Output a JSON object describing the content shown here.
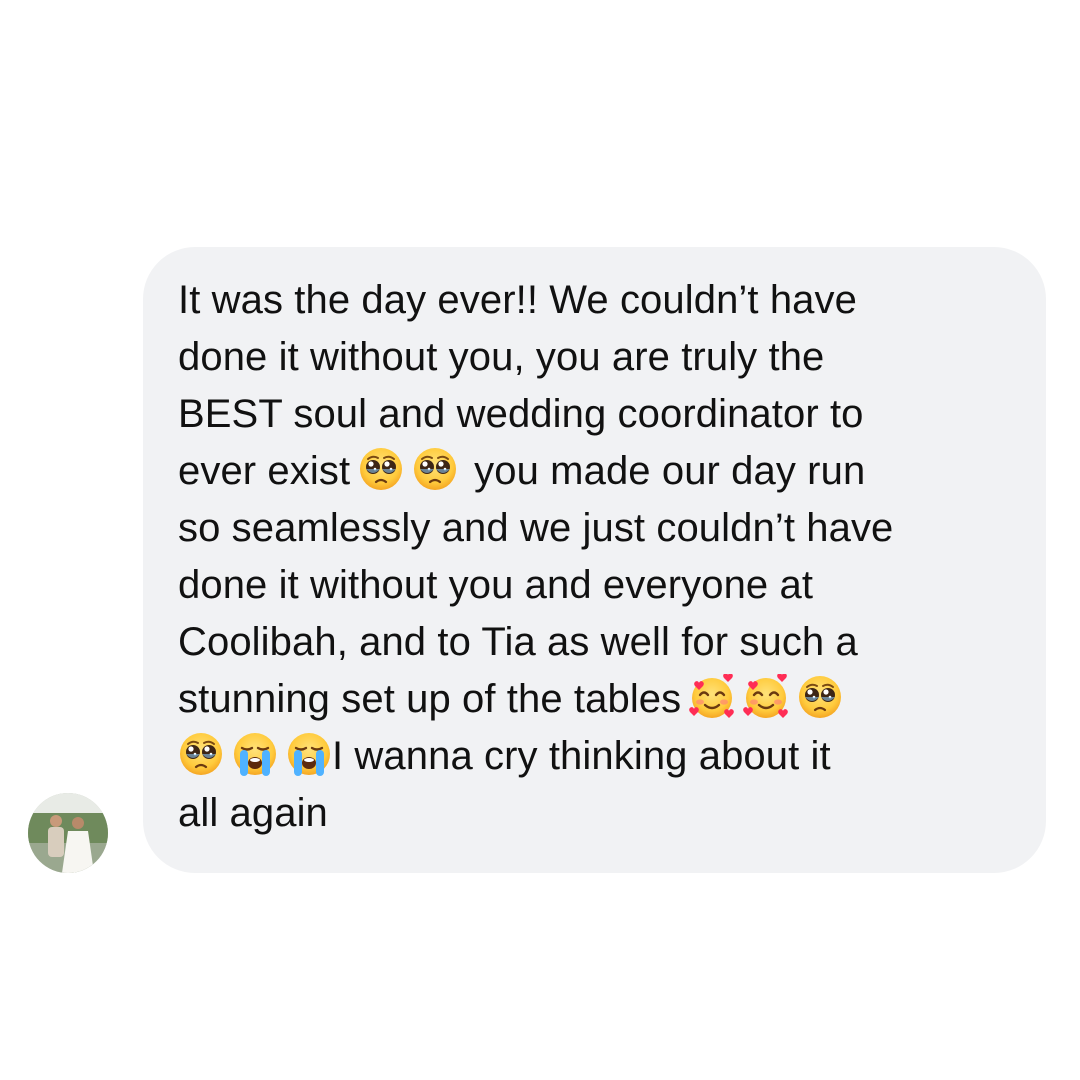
{
  "message": {
    "lines": [
      "It was the day ever!! We couldn’t have",
      "done it without you, you are truly the",
      "BEST soul and wedding coordinator to",
      "ever exist",
      "you made our day run",
      "so seamlessly and we just couldn’t have",
      "done it without you and everyone at",
      "Coolibah, and to Tia as well for such a",
      "stunning set up of the tables",
      "I wanna cry thinking about it",
      "all again"
    ],
    "bubble_color": "#f1f2f4",
    "text_color": "#111111"
  },
  "emojis": {
    "pleading": "pleading-face-icon",
    "hearts": "smiling-face-with-hearts-icon",
    "crying": "loudly-crying-face-icon"
  },
  "sender": {
    "avatar": "avatar-photo"
  }
}
